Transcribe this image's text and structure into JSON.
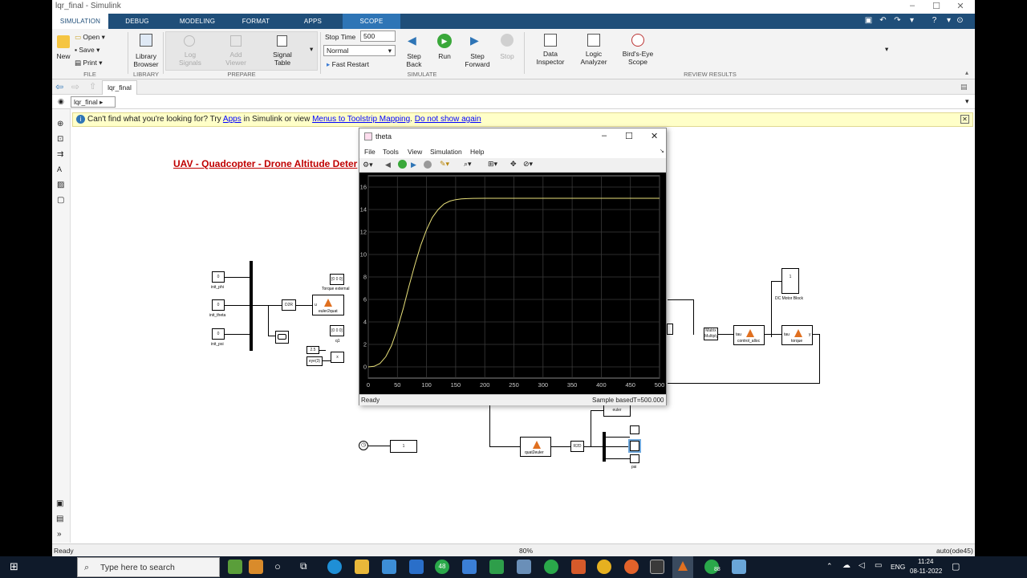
{
  "window": {
    "title": "lqr_final - Simulink"
  },
  "tabs": [
    {
      "label": "SIMULATION",
      "active": true
    },
    {
      "label": "DEBUG"
    },
    {
      "label": "MODELING"
    },
    {
      "label": "FORMAT"
    },
    {
      "label": "APPS"
    },
    {
      "label": "SCOPE"
    }
  ],
  "ribbon": {
    "file": {
      "new": "New",
      "open": "Open",
      "save": "Save",
      "print": "Print",
      "section": "FILE"
    },
    "library": {
      "browser_line1": "Library",
      "browser_line2": "Browser",
      "section": "LIBRARY"
    },
    "prepare": {
      "log_line1": "Log",
      "log_line2": "Signals",
      "add_line1": "Add",
      "add_line2": "Viewer",
      "signal_line1": "Signal",
      "signal_line2": "Table",
      "section": "PREPARE"
    },
    "simulate": {
      "stop_time_label": "Stop Time",
      "stop_time_value": "500",
      "mode_value": "Normal",
      "fast_restart": "Fast Restart",
      "step_back_line1": "Step",
      "step_back_line2": "Back",
      "run": "Run",
      "step_fwd_line1": "Step",
      "step_fwd_line2": "Forward",
      "stop": "Stop",
      "section": "SIMULATE"
    },
    "review": {
      "data_line1": "Data",
      "data_line2": "Inspector",
      "logic_line1": "Logic",
      "logic_line2": "Analyzer",
      "birds_line1": "Bird's-Eye",
      "birds_line2": "Scope",
      "section": "REVIEW RESULTS"
    }
  },
  "nav": {
    "tab": "lqr_final",
    "breadcrumb": "lqr_final"
  },
  "banner": {
    "text1": "Can't find what you're looking for? Try ",
    "link_apps": "Apps",
    "text2": " in Simulink or view ",
    "link_menus": "Menus to Toolstrip Mapping",
    "text3": ". ",
    "link_hide": "Do not show again"
  },
  "model": {
    "title": "UAV - Quadcopter - Drone Altitude Deter",
    "blocks": {
      "init_phi_val": "0",
      "init_phi": "init_phi",
      "init_theta_val": "0",
      "init_theta": "init_theta",
      "init_psi_val": "0",
      "init_psi": "init_psi",
      "d2r": "D2R",
      "torque_ext_val": "[0 0 0]",
      "torque_ext": "Torque external",
      "euler2quat": "euler2quat",
      "q1_val": "[0 0 0]",
      "q1": "q1",
      "gain_25": "2.5",
      "eye3": "eye(3)",
      "mult": "x",
      "dc_motor_val": "1",
      "dc_motor": "DC Motor Block",
      "matrix_mult_line1": "Matrix",
      "matrix_mult_line2": "Multiply",
      "control_alloc": "control_alloc",
      "torque": "torque",
      "euler": "euler",
      "clock_const": "1",
      "quat2euler": "quat2euler",
      "r2d": "R2D",
      "psi": "psi",
      "u_in": "u",
      "y_out": "y",
      "tau_in": "tau"
    }
  },
  "scope": {
    "title": "theta",
    "menu": [
      "File",
      "Tools",
      "View",
      "Simulation",
      "Help"
    ],
    "status_ready": "Ready",
    "status_mode": "Sample based",
    "status_time": "T=500.000"
  },
  "chart_data": {
    "type": "line",
    "title": "",
    "xlabel": "",
    "ylabel": "",
    "xlim": [
      0,
      500
    ],
    "ylim": [
      -1,
      17
    ],
    "xticks": [
      0,
      50,
      100,
      150,
      200,
      250,
      300,
      350,
      400,
      450,
      500
    ],
    "yticks": [
      0,
      2,
      4,
      6,
      8,
      10,
      12,
      14,
      16
    ],
    "grid": true,
    "series": [
      {
        "color": "#e8e07a",
        "x": [
          0,
          10,
          20,
          30,
          40,
          50,
          60,
          70,
          80,
          90,
          100,
          110,
          120,
          130,
          140,
          150,
          160,
          170,
          180,
          200,
          250,
          300,
          400,
          500
        ],
        "y": [
          0,
          0.05,
          0.3,
          0.9,
          1.9,
          3.4,
          5.2,
          7.2,
          9.1,
          10.8,
          12.2,
          13.3,
          14.0,
          14.5,
          14.75,
          14.88,
          14.94,
          14.97,
          14.99,
          15.0,
          15.0,
          15.0,
          15.0,
          15.0
        ]
      }
    ]
  },
  "status": {
    "ready": "Ready",
    "zoom": "80%",
    "solver": "auto(ode45)"
  },
  "taskbar": {
    "search_placeholder": "Type here to search",
    "lang": "ENG",
    "time": "11:24",
    "date": "08-11-2022",
    "badge1": "48",
    "badge2": "88"
  }
}
